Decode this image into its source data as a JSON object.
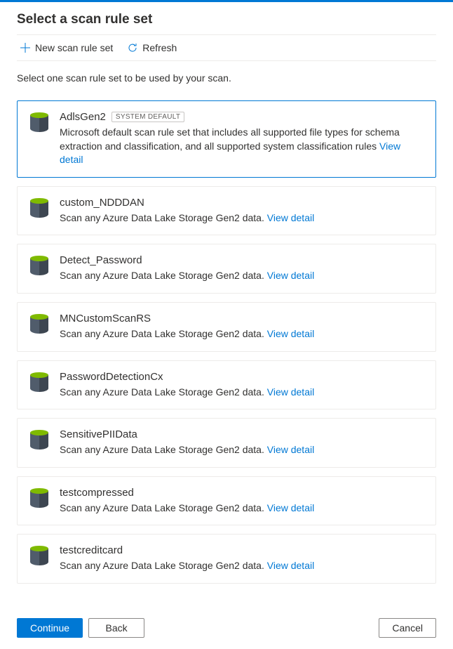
{
  "header": {
    "title": "Select a scan rule set"
  },
  "toolbar": {
    "new_label": "New scan rule set",
    "refresh_label": "Refresh"
  },
  "instruction": "Select one scan rule set to be used by your scan.",
  "badge_system_default": "SYSTEM DEFAULT",
  "link_view_detail": "View detail",
  "items": [
    {
      "name": "AdlsGen2",
      "system_default": true,
      "selected": true,
      "desc": "Microsoft default scan rule set that includes all supported file types for schema extraction and classification, and all supported system classification rules "
    },
    {
      "name": "custom_NDDDAN",
      "system_default": false,
      "selected": false,
      "desc": "Scan any Azure Data Lake Storage Gen2 data. "
    },
    {
      "name": "Detect_Password",
      "system_default": false,
      "selected": false,
      "desc": "Scan any Azure Data Lake Storage Gen2 data. "
    },
    {
      "name": "MNCustomScanRS",
      "system_default": false,
      "selected": false,
      "desc": "Scan any Azure Data Lake Storage Gen2 data. "
    },
    {
      "name": "PasswordDetectionCx",
      "system_default": false,
      "selected": false,
      "desc": "Scan any Azure Data Lake Storage Gen2 data. "
    },
    {
      "name": "SensitivePIIData",
      "system_default": false,
      "selected": false,
      "desc": "Scan any Azure Data Lake Storage Gen2 data. "
    },
    {
      "name": "testcompressed",
      "system_default": false,
      "selected": false,
      "desc": "Scan any Azure Data Lake Storage Gen2 data. "
    },
    {
      "name": "testcreditcard",
      "system_default": false,
      "selected": false,
      "desc": "Scan any Azure Data Lake Storage Gen2 data. "
    }
  ],
  "footer": {
    "continue_label": "Continue",
    "back_label": "Back",
    "cancel_label": "Cancel"
  }
}
